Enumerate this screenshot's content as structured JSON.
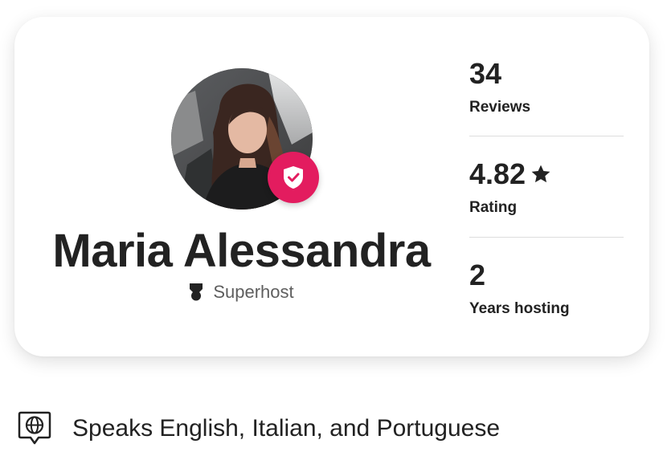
{
  "host": {
    "name": "Maria Alessandra",
    "badge": "Superhost",
    "verified_icon": "shield-check-icon",
    "badge_icon": "superhost-medal-icon"
  },
  "stats": [
    {
      "value": "34",
      "label": "Reviews"
    },
    {
      "value": "4.82",
      "label": "Rating",
      "icon": "star-icon"
    },
    {
      "value": "2",
      "label": "Years hosting"
    }
  ],
  "languages": {
    "icon": "language-globe-icon",
    "text": "Speaks English, Italian, and Portuguese"
  },
  "colors": {
    "accent": "#e31c5f",
    "text": "#222222",
    "muted": "#5e5e5e",
    "divider": "#dddddd"
  }
}
